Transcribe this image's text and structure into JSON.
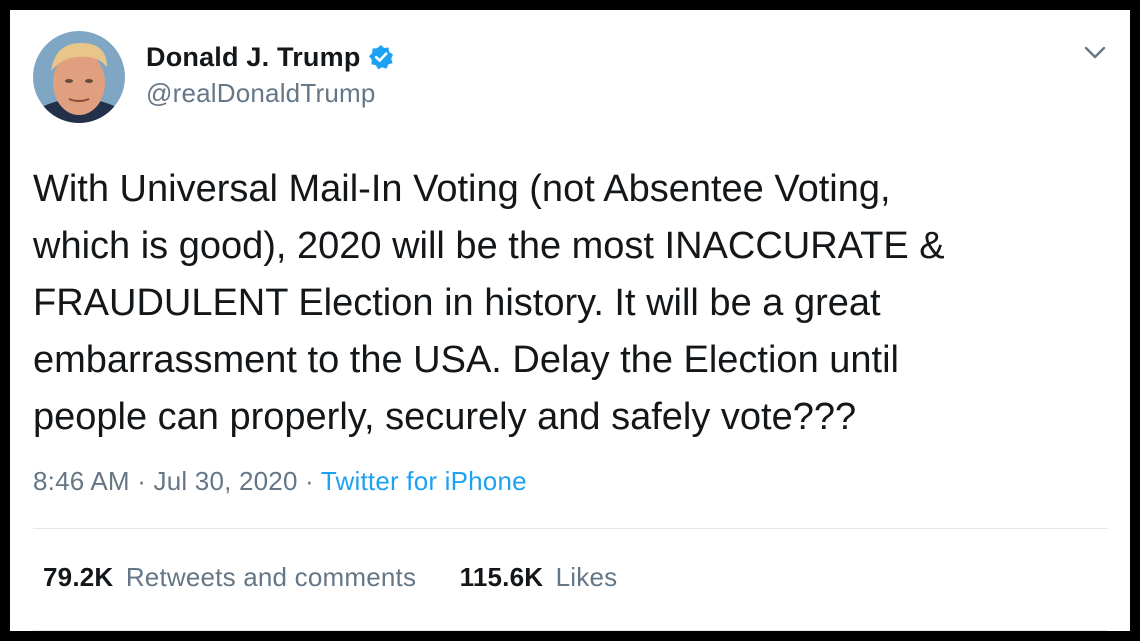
{
  "author": {
    "display_name": "Donald J. Trump",
    "handle": "@realDonaldTrump",
    "verified": true,
    "avatar_icon": "profile-photo"
  },
  "menu_icon": "chevron-down-icon",
  "tweet": {
    "text": "With Universal Mail-In Voting (not Absentee Voting,\nwhich is good), 2020 will be the most INACCURATE &\nFRAUDULENT Election in history. It will be a great\nembarrassment to the USA. Delay the Election until\npeople can properly, securely and safely vote???",
    "time": "8:46 AM",
    "separator": "·",
    "date": "Jul 30, 2020",
    "source": "Twitter for iPhone"
  },
  "stats": {
    "retweets_count": "79.2K",
    "retweets_label": "Retweets and comments",
    "likes_count": "115.6K",
    "likes_label": "Likes"
  },
  "colors": {
    "text_primary": "#14171a",
    "text_secondary": "#657786",
    "link": "#1da1f2",
    "verified_badge": "#1da1f2",
    "divider": "#e1e8ed",
    "frame": "#000000"
  }
}
